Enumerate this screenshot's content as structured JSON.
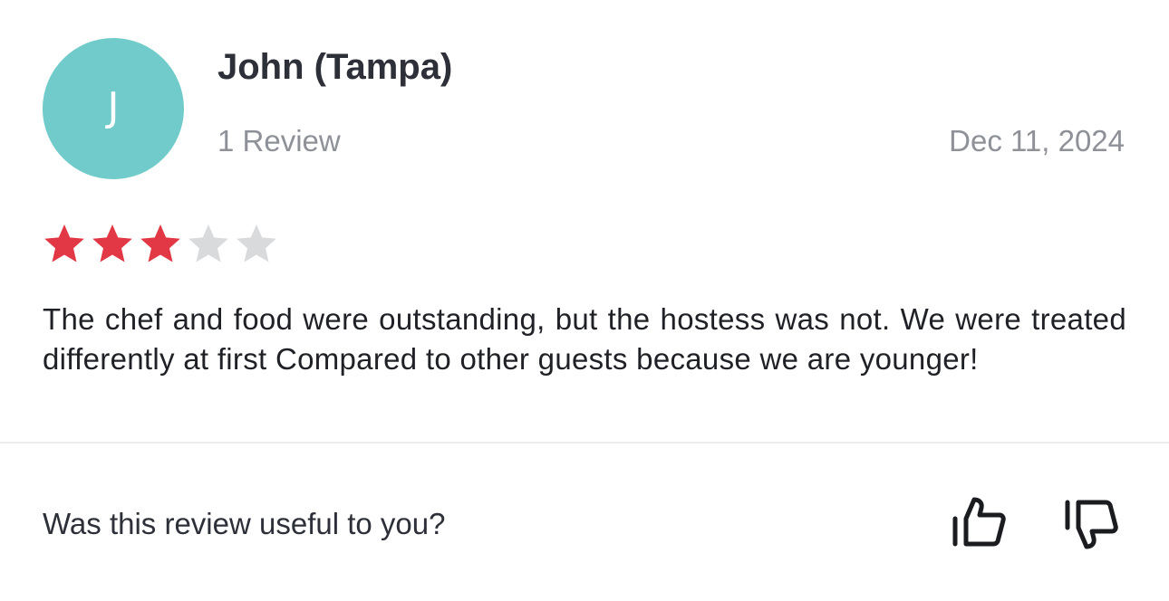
{
  "reviewer": {
    "avatar_letter": "J",
    "avatar_color": "#72cbcb",
    "name": "John (Tampa)",
    "review_count": "1 Review",
    "date": "Dec 11, 2024"
  },
  "rating": {
    "value": 3,
    "max": 5,
    "filled_color": "#e23744",
    "empty_color": "#d9dadc"
  },
  "review": {
    "text": "The chef and food were outstanding, but the hostess was not. We were treated differently at first Compared to other guests because we are younger!"
  },
  "feedback": {
    "question": "Was this review useful to you?",
    "helpful_icon": "thumbs-up-icon",
    "not_helpful_icon": "thumbs-down-icon"
  }
}
